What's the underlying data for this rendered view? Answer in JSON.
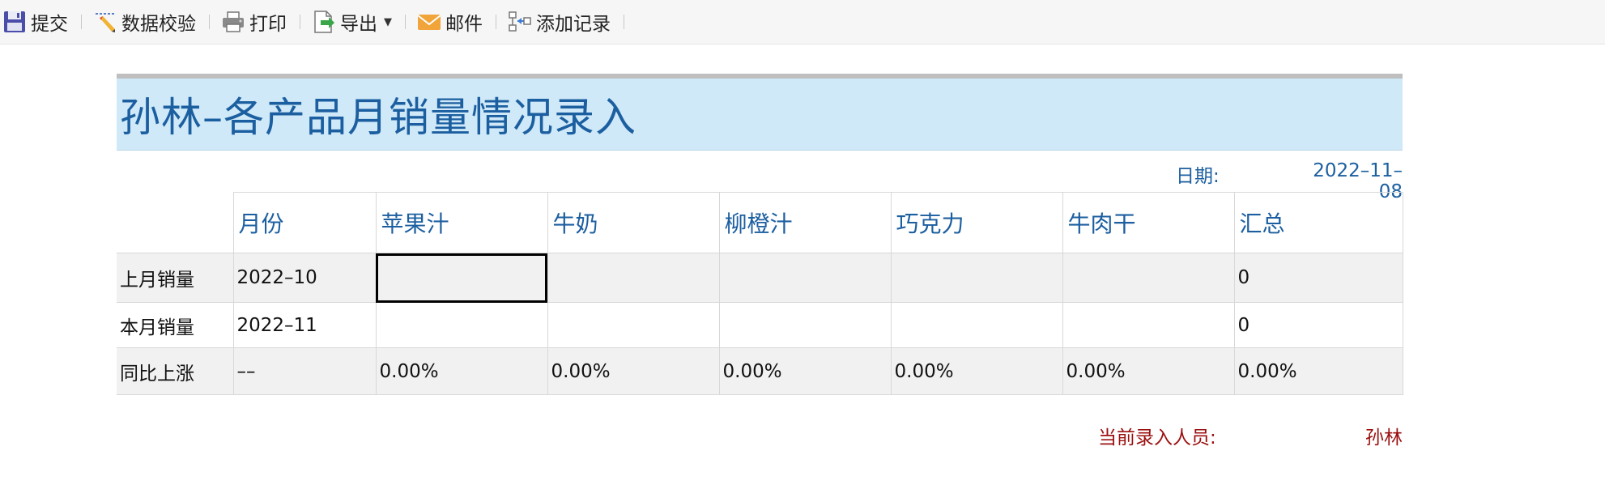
{
  "toolbar": {
    "items": [
      {
        "label": "提交",
        "icon": "save-icon"
      },
      {
        "label": "数据校验",
        "icon": "pencil-icon"
      },
      {
        "label": "打印",
        "icon": "printer-icon"
      },
      {
        "label": "导出",
        "icon": "export-icon"
      },
      {
        "label": "邮件",
        "icon": "mail-icon"
      },
      {
        "label": "添加记录",
        "icon": "add-record-icon"
      }
    ]
  },
  "report": {
    "title": "孙林–各产品月销量情况录入",
    "date_label": "日期:",
    "date_value": "2022–11–08",
    "columns": [
      "月份",
      "苹果汁",
      "牛奶",
      "柳橙汁",
      "巧克力",
      "牛肉干",
      "汇总"
    ],
    "rows": [
      {
        "label": "上月销量",
        "month": "2022–10",
        "values": [
          "",
          "",
          "",
          "",
          ""
        ],
        "total": "0"
      },
      {
        "label": "本月销量",
        "month": "2022–11",
        "values": [
          "",
          "",
          "",
          "",
          ""
        ],
        "total": "0"
      },
      {
        "label": "同比上涨",
        "month": "––",
        "values": [
          "0.00%",
          "0.00%",
          "0.00%",
          "0.00%",
          "0.00%"
        ],
        "total": "0.00%"
      }
    ],
    "entry_label": "当前录入人员:",
    "entry_value": "孙林"
  },
  "colors": {
    "title_band": "#cfe9f8",
    "title_text": "#1c5fa0",
    "footer_text": "#9b1010"
  }
}
